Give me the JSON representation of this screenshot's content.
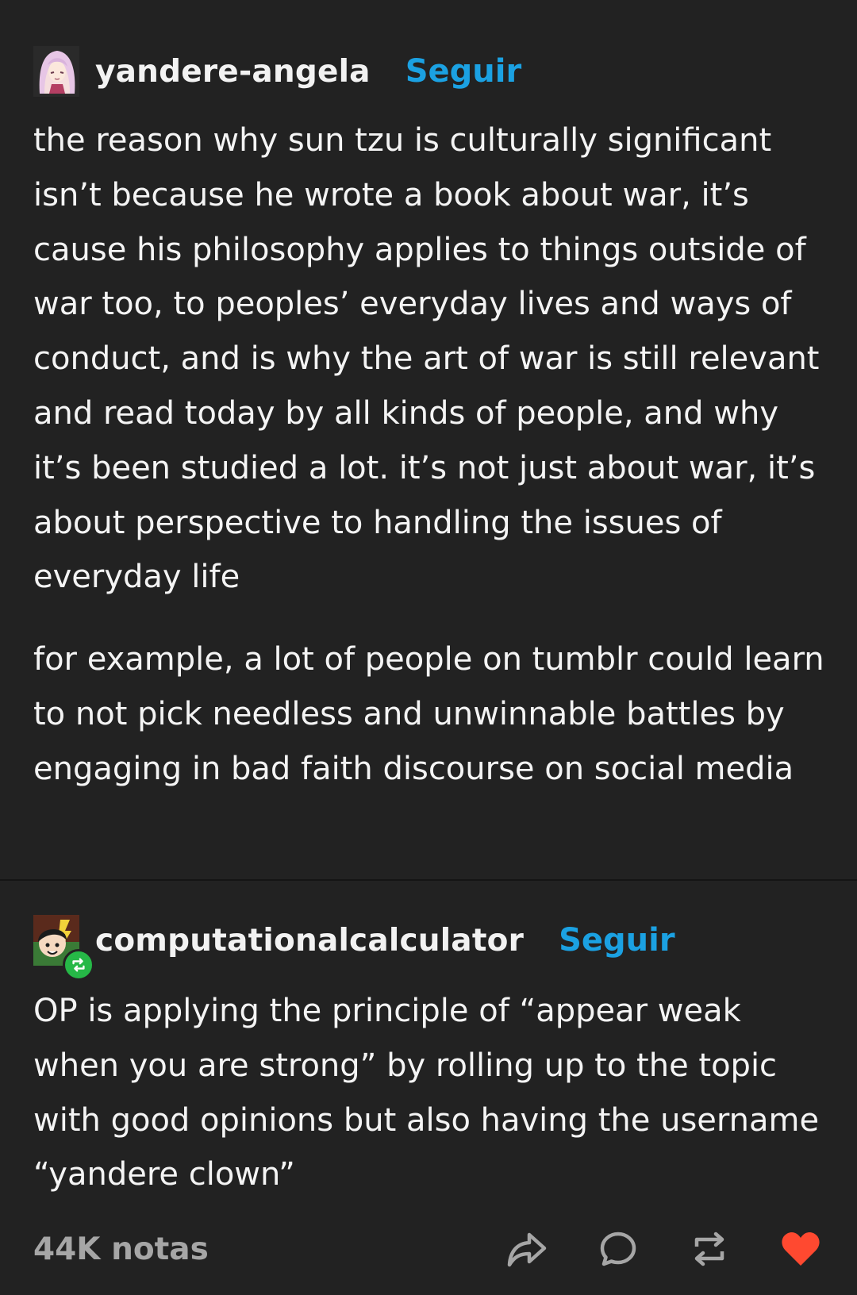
{
  "posts": [
    {
      "username": "yandere-angela",
      "follow_label": "Seguir",
      "avatar_icon": "anime-girl-avatar-icon",
      "paragraphs": [
        "the reason why sun tzu is culturally significant isn’t because he wrote a book about war, it’s cause his philosophy applies to things outside of war too, to peoples’ everyday lives and ways of conduct, and is why the art of war is still relevant and read today by all kinds of people, and why it’s been studied a lot. it’s not just about war, it’s about perspective to handling the issues of everyday life",
        "for example, a lot of people on tumblr could learn to not pick needless and unwinnable battles by engaging in bad faith discourse on social media"
      ]
    },
    {
      "username": "computationalcalculator",
      "follow_label": "Seguir",
      "avatar_icon": "cartoon-character-avatar-icon",
      "badge_icon": "reblog-badge-icon",
      "paragraphs": [
        "OP is applying the principle of “appear weak when you are strong” by rolling up to the topic with good opinions but also having the username “yandere clown”"
      ]
    }
  ],
  "footer": {
    "notes": "44K notas",
    "actions": [
      "share-icon",
      "comment-icon",
      "reblog-icon",
      "like-icon"
    ]
  },
  "colors": {
    "background": "#222222",
    "text": "#f4f4f4",
    "follow": "#1ba1e2",
    "notes": "#a6a6a6",
    "like": "#ff4930",
    "reblog_badge": "#26b847"
  }
}
